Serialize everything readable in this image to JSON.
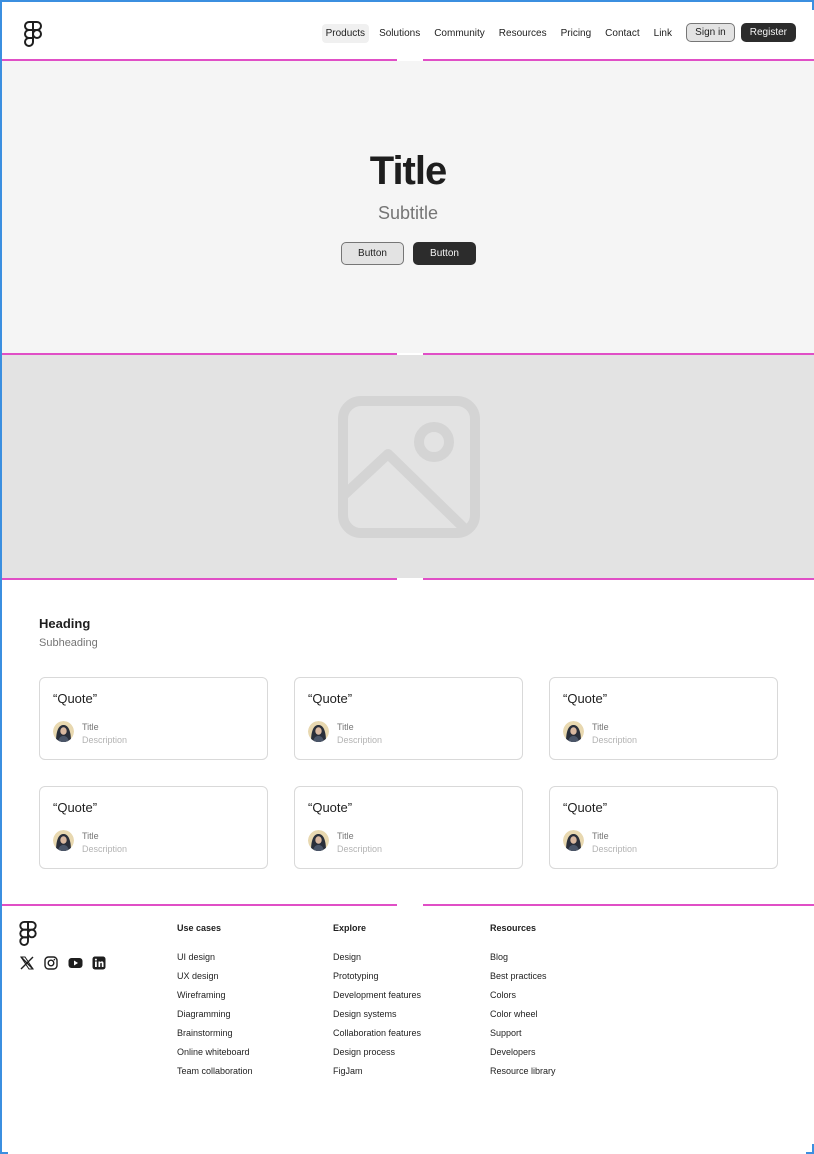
{
  "header": {
    "nav": [
      {
        "label": "Products",
        "active": true
      },
      {
        "label": "Solutions",
        "active": false
      },
      {
        "label": "Community",
        "active": false
      },
      {
        "label": "Resources",
        "active": false
      },
      {
        "label": "Pricing",
        "active": false
      },
      {
        "label": "Contact",
        "active": false
      },
      {
        "label": "Link",
        "active": false
      }
    ],
    "sign_in_label": "Sign in",
    "register_label": "Register"
  },
  "hero": {
    "title": "Title",
    "subtitle": "Subtitle",
    "primary_button": "Button",
    "secondary_button": "Button"
  },
  "testimonials": {
    "heading": "Heading",
    "subheading": "Subheading",
    "cards": [
      {
        "quote": "“Quote”",
        "title": "Title",
        "description": "Description"
      },
      {
        "quote": "“Quote”",
        "title": "Title",
        "description": "Description"
      },
      {
        "quote": "“Quote”",
        "title": "Title",
        "description": "Description"
      },
      {
        "quote": "“Quote”",
        "title": "Title",
        "description": "Description"
      },
      {
        "quote": "“Quote”",
        "title": "Title",
        "description": "Description"
      },
      {
        "quote": "“Quote”",
        "title": "Title",
        "description": "Description"
      }
    ]
  },
  "footer": {
    "social_icons": [
      "x-icon",
      "instagram-icon",
      "youtube-icon",
      "linkedin-icon"
    ],
    "columns": [
      {
        "title": "Use cases",
        "links": [
          "UI design",
          "UX design",
          "Wireframing",
          "Diagramming",
          "Brainstorming",
          "Online whiteboard",
          "Team collaboration"
        ]
      },
      {
        "title": "Explore",
        "links": [
          "Design",
          "Prototyping",
          "Development features",
          "Design systems",
          "Collaboration features",
          "Design process",
          "FigJam"
        ]
      },
      {
        "title": "Resources",
        "links": [
          "Blog",
          "Best practices",
          "Colors",
          "Color wheel",
          "Support",
          "Developers",
          "Resource library"
        ]
      }
    ]
  },
  "colors": {
    "accent_dark": "#2c2c2c",
    "guide_magenta": "#e04fc6",
    "frame_blue": "#3b8fe0",
    "hero_bg": "#f5f5f5",
    "image_bg": "#e3e3e3"
  }
}
